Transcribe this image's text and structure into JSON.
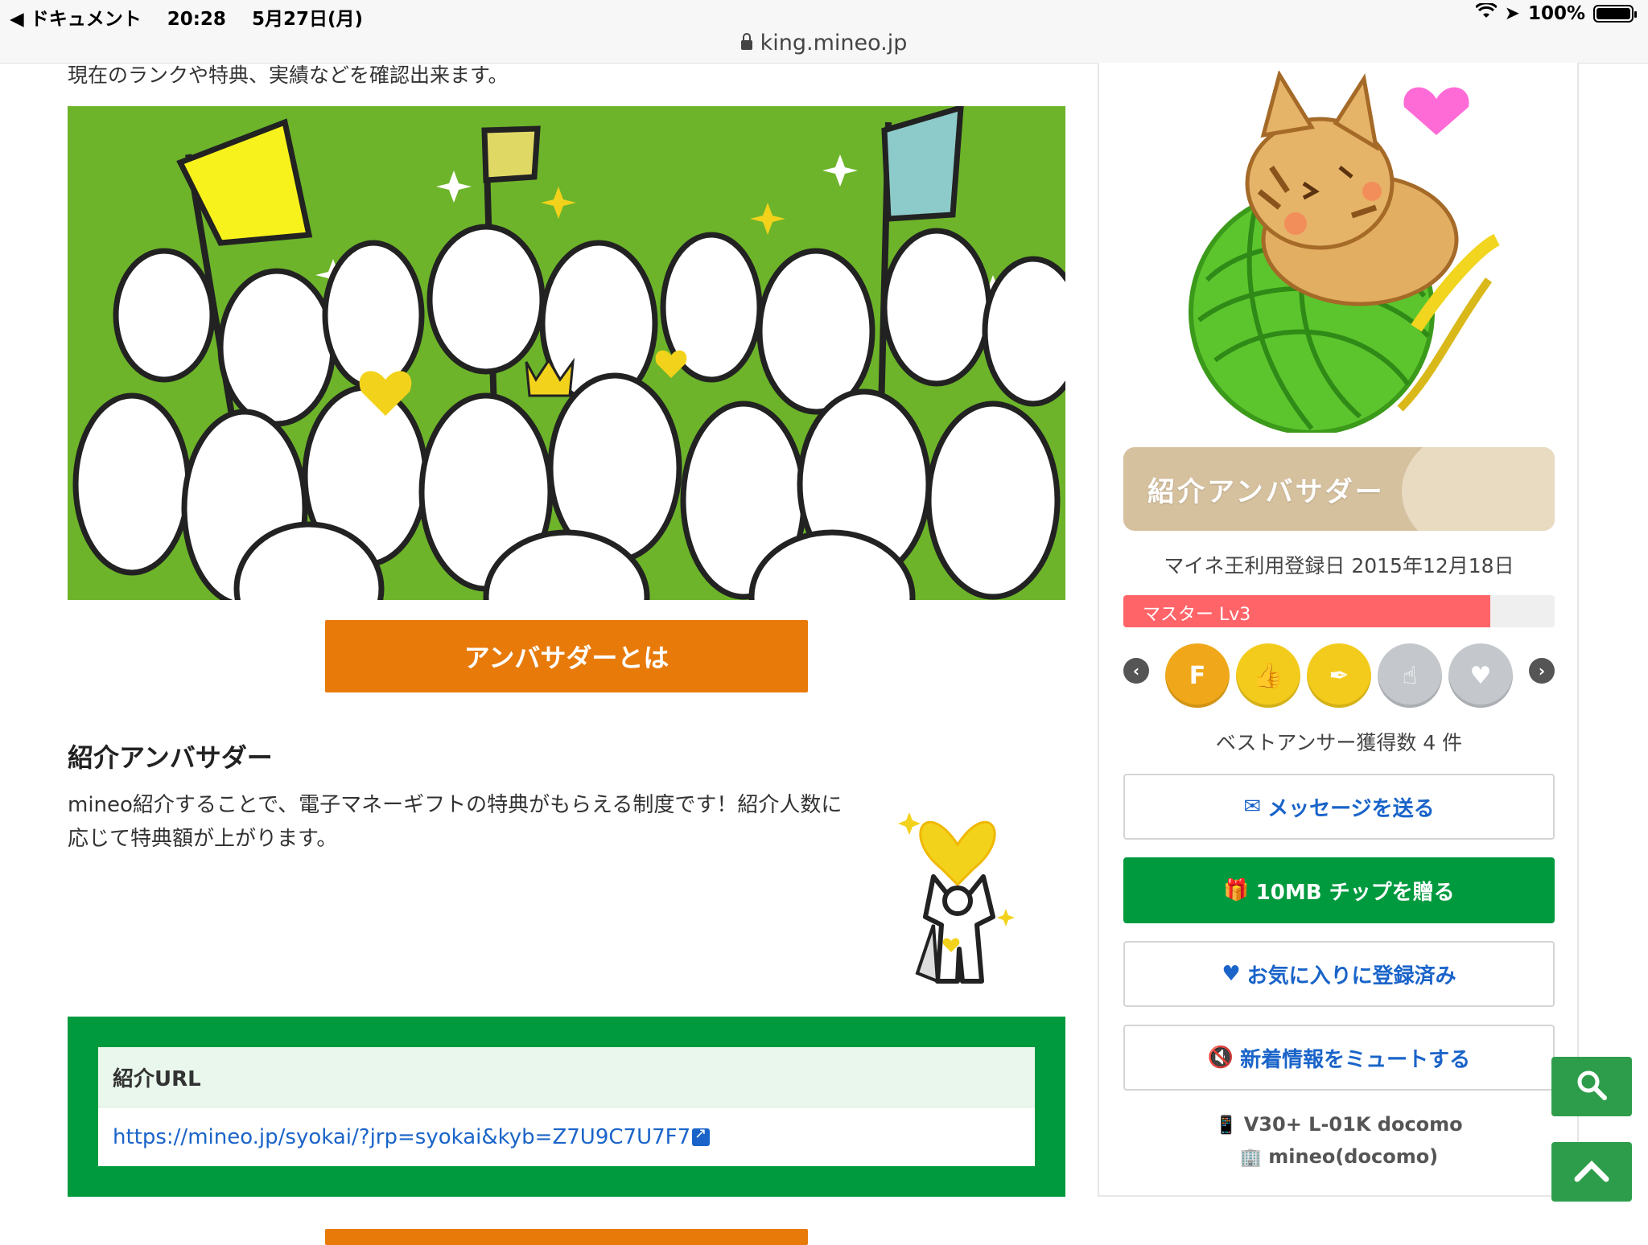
{
  "status": {
    "back_app": "◀ ドキュメント",
    "time": "20:28",
    "date": "5月27日(月)",
    "battery": "100%"
  },
  "browser": {
    "url": "king.mineo.jp"
  },
  "main": {
    "intro": "現在のランクや特典、実績などを確認出来ます。",
    "ambassador_button": "アンバサダーとは",
    "section_title": "紹介アンバサダー",
    "section_desc": "mineo紹介することで、電子マネーギフトの特典がもらえる制度です！紹介人数に応じて特典額が上がります。",
    "referral": {
      "heading": "紹介URL",
      "url": "https://mineo.jp/syokai/?jrp=syokai&kyb=Z7U9C7U7F7"
    }
  },
  "sidebar": {
    "rank_label": "紹介アンバサダー",
    "reg_date": "マイネ王利用登録日 2015年12月18日",
    "level": {
      "label": "マスター Lv3",
      "progress": 0.85
    },
    "badges": [
      {
        "icon": "f-badge-icon",
        "glyph": "F",
        "color": "#f0a81a"
      },
      {
        "icon": "thumbs-up-badge-icon",
        "glyph": "👍",
        "color": "#f3cb1c"
      },
      {
        "icon": "pen-badge-icon",
        "glyph": "✒",
        "color": "#f3cb1c"
      },
      {
        "icon": "tap-badge-icon",
        "glyph": "☝",
        "color": "#c4c8cc"
      },
      {
        "icon": "hearts-badge-icon",
        "glyph": "♥",
        "color": "#c4c8cc"
      }
    ],
    "best_answer": "ベストアンサー獲得数 4 件",
    "buttons": {
      "message": "メッセージを送る",
      "tip": "10MB チップを贈る",
      "favorite": "お気に入りに登録済み",
      "mute": "新着情報をミュートする"
    },
    "device": "V30+ L-01K docomo",
    "carrier": "mineo(docomo)"
  },
  "colors": {
    "accent_green": "#009a3e",
    "orange": "#e87a0a",
    "level_red": "#ff6469",
    "link_blue": "#1a64c9"
  }
}
